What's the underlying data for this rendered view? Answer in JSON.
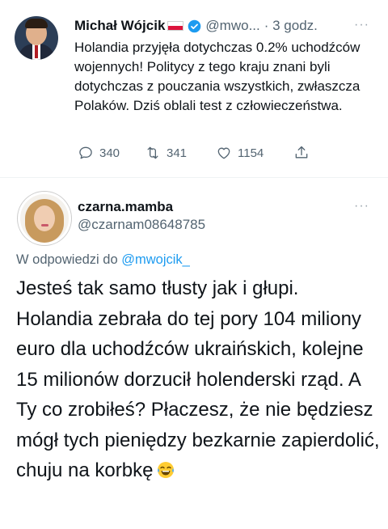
{
  "tweet": {
    "author_name": "Michał Wójcik",
    "handle": "@mwo...",
    "time": "· 3 godz.",
    "more_label": "···",
    "text": "Holandia przyjęła dotychczas 0.2% uchodźców wojennych! Politycy z tego kraju znani byli dotychczas z pouczania wszystkich, zwłaszcza Polaków. Dziś oblali test z człowieczeństwa.",
    "replies": "340",
    "retweets": "341",
    "likes": "1154"
  },
  "reply": {
    "author_name": "czarna.mamba",
    "handle": "@czarnam08648785",
    "more_label": "···",
    "replying_prefix": "W odpowiedzi do",
    "replying_mention": "@mwojcik_",
    "text": "Jesteś tak samo tłusty jak i głupi. Holandia zebrała do tej pory 104 miliony euro dla uchodźców ukraińskich, kolejne 15 milionów dorzucił holenderski rząd. A Ty co zrobiłeś? Płaczesz, że nie będziesz mógł tych pieniędzy bezkarnie zapierdolić, chuju na korbkę"
  },
  "icons": {
    "verified": "verified-badge-icon",
    "flag": "poland-flag-icon",
    "reply": "reply-icon",
    "retweet": "retweet-icon",
    "like": "heart-icon",
    "share": "share-icon",
    "emoji": "laughing-tears-emoji-icon"
  },
  "colors": {
    "accent": "#1d9bf0",
    "muted_text": "#536471",
    "text": "#0f1419"
  }
}
